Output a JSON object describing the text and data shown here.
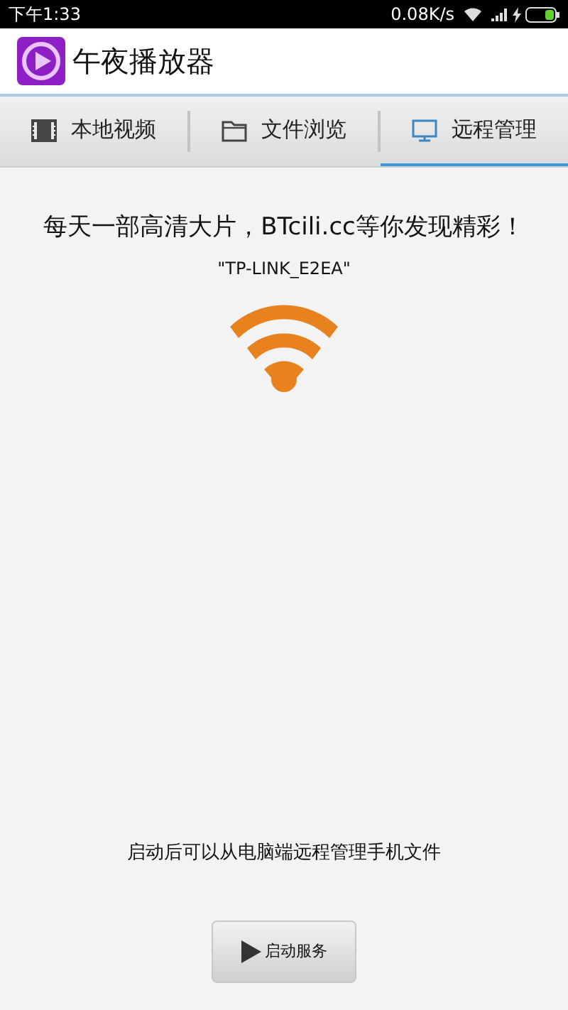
{
  "status_bar": {
    "time": "下午1:33",
    "speed": "0.08K/s"
  },
  "app_bar": {
    "title": "午夜播放器"
  },
  "tabs": [
    {
      "label": "本地视频",
      "selected": false
    },
    {
      "label": "文件浏览",
      "selected": false
    },
    {
      "label": "远程管理",
      "selected": true
    }
  ],
  "banner": "每天一部高清大片，BTcili.cc等你发现精彩！",
  "network": "\"TP-LINK_E2EA\"",
  "hint": "启动后可以从电脑端远程管理手机文件",
  "button": "启动服务"
}
